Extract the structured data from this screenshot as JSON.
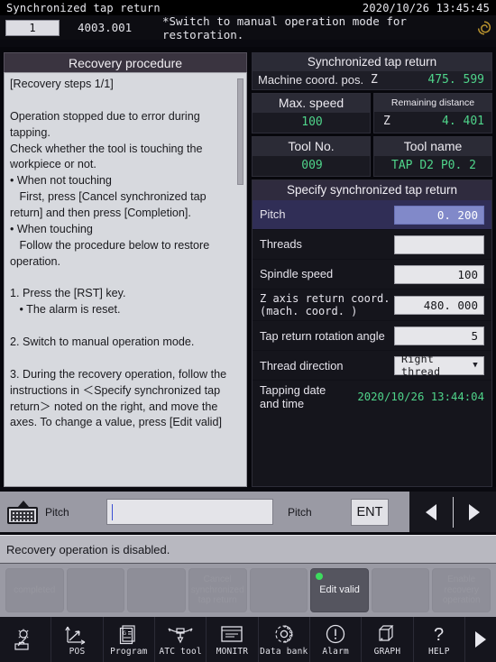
{
  "titlebar": {
    "screen_title": "Synchronized tap return",
    "datetime": "2020/10/26 13:45:45"
  },
  "alarm": {
    "number": "1",
    "code": "4003.001",
    "message": "*Switch to manual operation mode for restoration.",
    "icon": "alarm-spiral-icon"
  },
  "recovery_panel": {
    "title": "Recovery procedure",
    "text": "[Recovery steps 1/1]\n\nOperation stopped due to error during\ntapping.\nCheck whether the tool is touching the\nworkpiece or not.\n• When not touching\n   First, press [Cancel synchronized tap\nreturn] and then press [Completion].\n• When touching\n   Follow the procedure below to restore\noperation.\n\n1. Press the [RST] key.\n   • The alarm is reset.\n\n2. Switch to manual operation mode.\n\n3. During the recovery operation, follow the\ninstructions in ＜Specify synchronized tap\nreturn＞ noted on the right, and move the\naxes. To change a value, press [Edit valid]"
  },
  "status_panel": {
    "title": "Synchronized tap return",
    "machine_coord": {
      "label": "Machine coord. pos.",
      "axis": "Z",
      "value": "475. 599"
    },
    "max_speed": {
      "label": "Max. speed",
      "value": "100"
    },
    "remaining_distance": {
      "label": "Remaining distance",
      "axis": "Z",
      "value": "4. 401"
    },
    "tool_no": {
      "label": "Tool No.",
      "value": "009"
    },
    "tool_name": {
      "label": "Tool name",
      "value": "TAP D2 P0. 2"
    }
  },
  "specify_panel": {
    "title": "Specify synchronized tap return",
    "rows": [
      {
        "label": "Pitch",
        "value": "0. 200",
        "highlight": true,
        "kind": "field"
      },
      {
        "label": "Threads",
        "value": "",
        "highlight": false,
        "kind": "field"
      },
      {
        "label": "Spindle speed",
        "value": "100",
        "highlight": false,
        "kind": "field"
      },
      {
        "label": "Z axis return coord.",
        "label2": "(mach. coord. )",
        "value": "480. 000",
        "highlight": false,
        "kind": "field"
      },
      {
        "label": "Tap return rotation angle",
        "value": "5",
        "highlight": false,
        "kind": "field"
      },
      {
        "label": "Thread direction",
        "value": "Right thread",
        "highlight": false,
        "kind": "select"
      },
      {
        "label": "Tapping date",
        "label2": "and time",
        "value": "2020/10/26 13:44:04",
        "highlight": false,
        "kind": "date"
      }
    ]
  },
  "input_bar": {
    "keyboard_icon": "keyboard-icon",
    "keyboard_label": "Pitch",
    "input_value": "",
    "input_placeholder": "",
    "field_label": "Pitch",
    "enter_label": "ENT",
    "prev_icon": "arrow-left-icon",
    "next_icon": "arrow-right-icon"
  },
  "status_message": "Recovery operation is disabled.",
  "softkeys": [
    {
      "label": "completed",
      "state": "disabled"
    },
    {
      "label": "",
      "state": "blank"
    },
    {
      "label": "",
      "state": "blank"
    },
    {
      "label": "Cancel\nsynchronized\ntap return",
      "state": "disabled"
    },
    {
      "label": "",
      "state": "blank"
    },
    {
      "label": "Edit valid",
      "state": "active",
      "indicator": true
    },
    {
      "label": "",
      "state": "blank"
    },
    {
      "label": "Enable\nrecovery\noperation",
      "state": "disabled"
    }
  ],
  "bottom_nav": [
    {
      "label": "",
      "icon": "tool-lamp-icon"
    },
    {
      "label": "POS",
      "icon": "axis-position-icon"
    },
    {
      "label": "Program",
      "icon": "program-sheet-icon"
    },
    {
      "label": "ATC tool",
      "icon": "atc-tool-icon"
    },
    {
      "label": "MONITR",
      "icon": "monitor-icon"
    },
    {
      "label": "Data bank",
      "icon": "gear-icon"
    },
    {
      "label": "Alarm",
      "icon": "alert-circle-icon"
    },
    {
      "label": "GRAPH",
      "icon": "cube-icon"
    },
    {
      "label": "HELP",
      "icon": "question-mark-icon"
    }
  ],
  "nav_more_icon": "arrow-right-icon",
  "colors": {
    "accent_green": "#4fd48a",
    "highlight_purple": "#302e56",
    "field_active": "#8189c9",
    "indicator_green": "#3ddb5e",
    "alarm_icon_gold": "#b8922e"
  }
}
